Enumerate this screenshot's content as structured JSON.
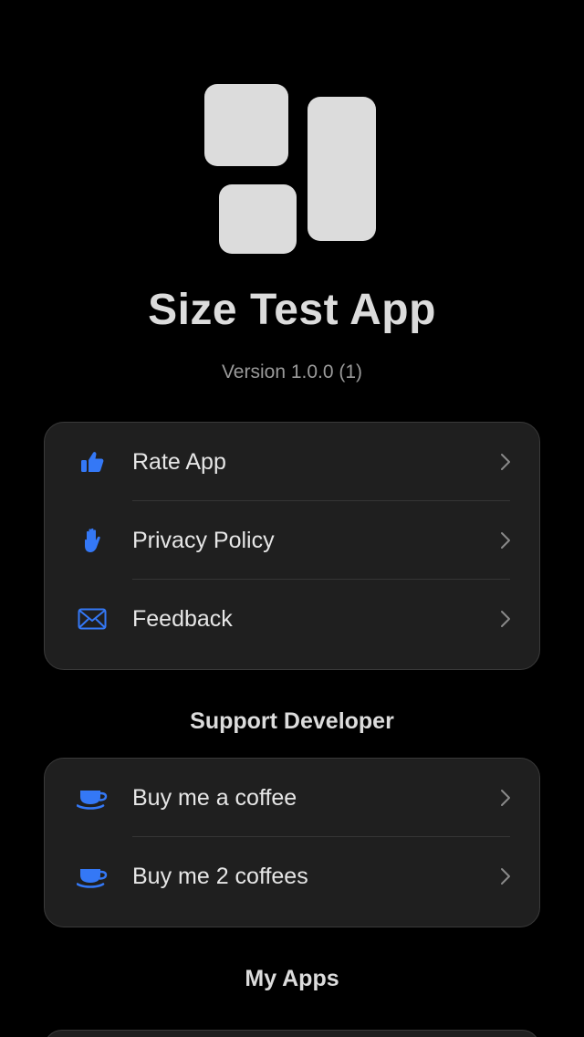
{
  "app": {
    "title": "Size Test App",
    "version": "Version 1.0.0 (1)"
  },
  "colors": {
    "accent": "#3478f6",
    "background": "#000000",
    "card": "#1f1f1f"
  },
  "menu": [
    {
      "label": "Rate App",
      "icon": "thumbs-up-icon"
    },
    {
      "label": "Privacy Policy",
      "icon": "hand-raised-icon"
    },
    {
      "label": "Feedback",
      "icon": "envelope-icon"
    }
  ],
  "support": {
    "title": "Support Developer",
    "items": [
      {
        "label": "Buy me a coffee",
        "icon": "coffee-cup-icon"
      },
      {
        "label": "Buy me 2 coffees",
        "icon": "coffee-cup-icon"
      }
    ]
  },
  "my_apps": {
    "title": "My Apps"
  }
}
